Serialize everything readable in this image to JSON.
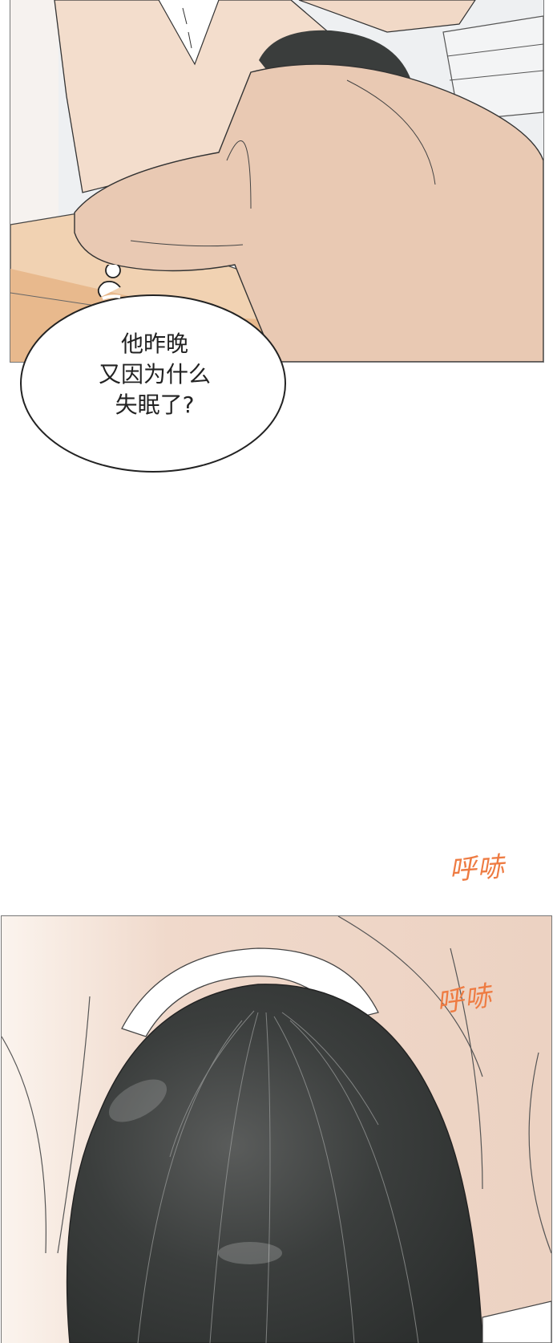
{
  "thought_bubble": {
    "lines": [
      "他昨晚",
      "又因为什么",
      "失眠了?"
    ]
  },
  "sound_effects": {
    "first": "呼哧",
    "second": "呼哧"
  },
  "colors": {
    "skin_coat": "#e9c9b3",
    "hair": "#3a3d3c",
    "sfx_orange": "#ee7b42",
    "desk": "#e8b98d"
  }
}
